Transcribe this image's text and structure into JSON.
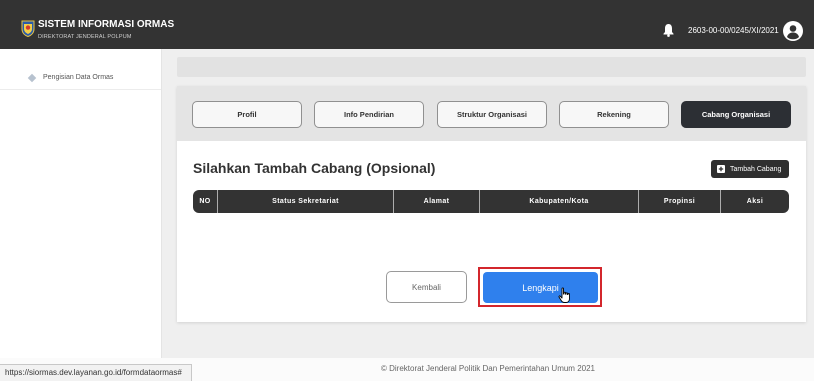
{
  "header": {
    "app_title": "SISTEM INFORMASI ORMAS",
    "app_subtitle": "DIREKTORAT JENDERAL POLPUM",
    "registration_number": "2603-00-00/0245/XI/2021",
    "logo_icon": "ormas-emblem-icon",
    "notification_icon": "bell-icon",
    "user_icon": "user-avatar-icon"
  },
  "sidebar": {
    "items": [
      {
        "label": "Pengisian Data Ormas",
        "icon": "diamond-bullet-icon"
      }
    ]
  },
  "tabs": [
    {
      "label": "Profil",
      "active": false
    },
    {
      "label": "Info Pendirian",
      "active": false
    },
    {
      "label": "Struktur Organisasi",
      "active": false
    },
    {
      "label": "Rekening",
      "active": false
    },
    {
      "label": "Cabang Organisasi",
      "active": true
    }
  ],
  "section": {
    "heading": "Silahkan Tambah Cabang (Opsional)",
    "add_button_label": "Tambah Cabang",
    "add_button_icon": "plus-square-icon"
  },
  "table": {
    "columns": [
      "NO",
      "Status Sekretariat",
      "Alamat",
      "Kabupaten/Kota",
      "Propinsi",
      "Aksi"
    ]
  },
  "actions": {
    "back_label": "Kembali",
    "submit_label": "Lengkapi",
    "cursor_icon": "hand-pointer-icon"
  },
  "footer": {
    "copyright": "© Direktorat Jenderal Politik Dan Pemerintahan Umum 2021"
  },
  "status_bar": {
    "url": "https://siormas.dev.layanan.go.id/formdataormas#"
  },
  "colors": {
    "dark": "#333333",
    "accent": "#2f80ed",
    "highlight": "#d3262c",
    "page_background": "#efefef"
  }
}
